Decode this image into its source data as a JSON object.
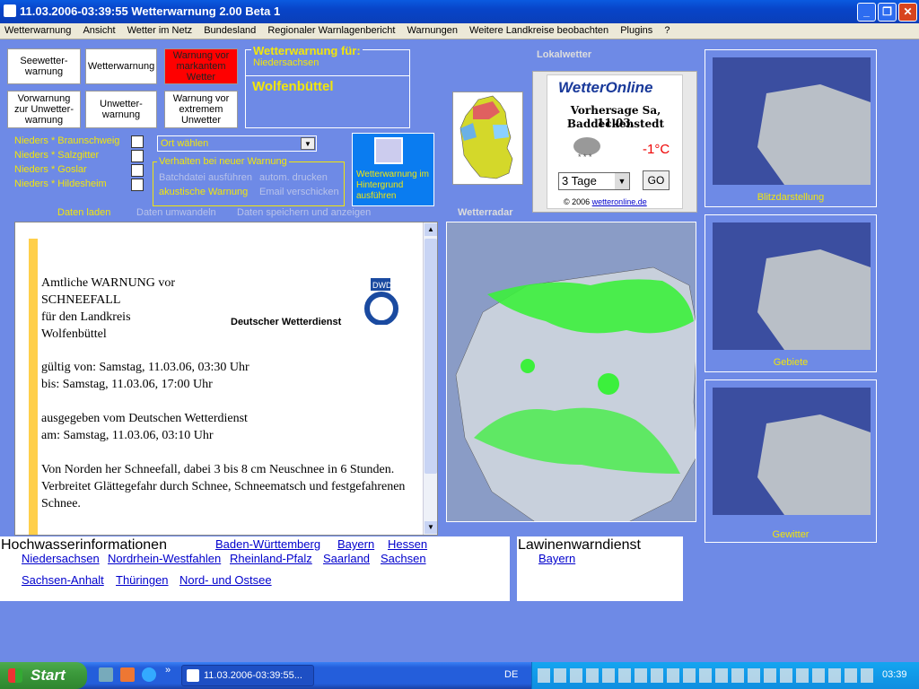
{
  "window": {
    "title": "11.03.2006-03:39:55 Wetterwarnung 2.00 Beta 1"
  },
  "menu": [
    "Wetterwarnung",
    "Ansicht",
    "Wetter im Netz",
    "Bundesland",
    "Regionaler Warnlagenbericht",
    "Warnungen",
    "Weitere Landkreise beobachten",
    "Plugins",
    "?"
  ],
  "warn_buttons": {
    "seewetter": "Seewetter-warnung",
    "wetter": "Wetterwarnung",
    "markant": "Warnung vor markantem Wetter",
    "vorwarnung": "Vorwarnung zur Unwetter-warnung",
    "unwetter": "Unwetter-warnung",
    "extrem": "Warnung vor extremem Unwetter"
  },
  "warning_for": {
    "heading": "Wetterwarnung für:",
    "state": "Niedersachsen",
    "district": "Wolfenbüttel"
  },
  "regions": [
    "Nieders * Braunschweig",
    "Nieders * Salzgitter",
    "Nieders * Goslar",
    "Nieders * Hildesheim"
  ],
  "ort_select": "Ort wählen",
  "behavior": {
    "legend": "Verhalten bei neuer Warnung",
    "batch": "Batchdatei ausführen",
    "print": "autom. drucken",
    "sound": "akustische Warnung",
    "email": "Email verschicken"
  },
  "background_button": "Wetterwarnung im Hintergrund ausführen",
  "data_actions": {
    "load": "Daten laden",
    "convert": "Daten umwandeln",
    "save": "Daten speichern und anzeigen"
  },
  "lokalwetter": {
    "title": "Lokalwetter",
    "brand": "WetterOnline",
    "forecast": "Vorhersage Sa, 11.03.",
    "place": "Baddeckenstedt",
    "temp": "-1°C",
    "days": "3 Tage",
    "go": "GO",
    "copyright": "© 2006",
    "copyright_link": "wetteronline.de"
  },
  "radar_title": "Wetterradar",
  "thumbnails": [
    "Blitzdarstellung",
    "Gebiete",
    "Gewitter"
  ],
  "warning_doc": {
    "lines": [
      "Amtliche WARNUNG vor",
      "SCHNEEFALL",
      "für den Landkreis",
      "Wolfenbüttel"
    ],
    "dwd": "Deutscher Wetterdienst",
    "dwd_logo": "DWD",
    "valid_from": "gültig von: Samstag, 11.03.06, 03:30 Uhr",
    "valid_to": "bis: Samstag, 11.03.06, 17:00 Uhr",
    "issued_by": "ausgegeben vom Deutschen Wetterdienst",
    "issued_at": "am: Samstag, 11.03.06, 03:10 Uhr",
    "body1": "Von Norden her Schneefall, dabei 3 bis 8 cm Neuschnee in 6 Stunden.",
    "body2": "Verbreitet Glättegefahr durch Schnee, Schneematsch und festgefahrenen Schnee."
  },
  "hochwasser": {
    "title": "Hochwasserinformationen",
    "links": [
      "Baden-Württemberg",
      "Bayern",
      "Hessen",
      "Niedersachsen",
      "Nordrhein-Westfahlen",
      "Rheinland-Pfalz",
      "Saarland",
      "Sachsen",
      "Sachsen-Anhalt",
      "Thüringen",
      "Nord- und Ostsee"
    ]
  },
  "lawinen": {
    "title": "Lawinenwarndienst",
    "links": [
      "Bayern"
    ]
  },
  "taskbar": {
    "start": "Start",
    "task": "11.03.2006-03:39:55...",
    "lang": "DE",
    "clock": "03:39"
  }
}
